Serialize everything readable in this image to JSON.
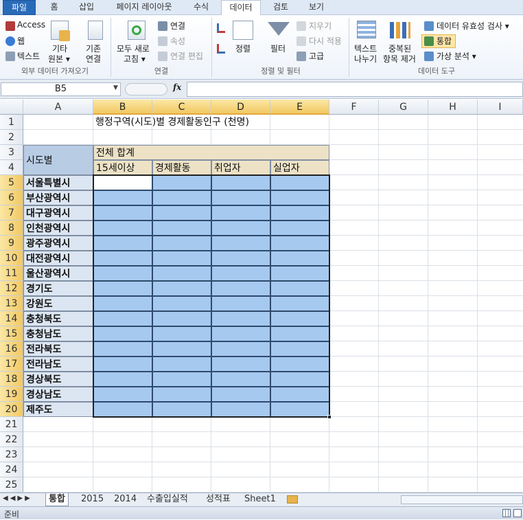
{
  "ribbon_tabs": [
    "파일",
    "홈",
    "삽입",
    "페이지 레이아웃",
    "수식",
    "데이터",
    "검토",
    "보기"
  ],
  "ribbon": {
    "ext_access": "Access",
    "ext_web": "웹",
    "ext_text": "텍스트",
    "ext_other_1": "기타",
    "ext_other_2": "원본 ▾",
    "existing_1": "기존",
    "existing_2": "연결",
    "group_external": "외부 데이터 가져오기",
    "refresh_1": "모두 새로",
    "refresh_2": "고침 ▾",
    "connections": "연결",
    "properties": "속성",
    "edit_links": "연결 편집",
    "group_connections": "연결",
    "sort": "정렬",
    "filter": "필터",
    "clear": "지우기",
    "reapply": "다시 적용",
    "advanced": "고급",
    "group_sort": "정렬 및 필터",
    "text_to_cols_1": "텍스트",
    "text_to_cols_2": "나누기",
    "remove_dup_1": "중복된",
    "remove_dup_2": "항목 제거",
    "validation": "데이터 유효성 검사 ▾",
    "consolidate": "통합",
    "whatif": "가상 분석 ▾",
    "group_tools": "데이터 도구"
  },
  "formula_bar": {
    "name_box": "B5",
    "fx": "fx",
    "formula": ""
  },
  "columns": [
    "A",
    "B",
    "C",
    "D",
    "E",
    "F",
    "G",
    "H",
    "I"
  ],
  "rows": [
    "1",
    "2",
    "3",
    "4",
    "5",
    "6",
    "7",
    "8",
    "9",
    "10",
    "11",
    "12",
    "13",
    "14",
    "15",
    "16",
    "17",
    "18",
    "19",
    "20",
    "21",
    "22",
    "23",
    "24",
    "25"
  ],
  "sheet": {
    "title": "행정구역(시도)별 경제활동인구 (천명)",
    "region_header": "시도별",
    "total_header": "전체 합계",
    "sub_headers": [
      "15세이상",
      "경제활동",
      "취업자",
      "실업자"
    ],
    "regions": [
      "서울특별시",
      "부산광역시",
      "대구광역시",
      "인천광역시",
      "광주광역시",
      "대전광역시",
      "울산광역시",
      "경기도",
      "강원도",
      "충청북도",
      "충청남도",
      "전라북도",
      "전라남도",
      "경상북도",
      "경상남도",
      "제주도"
    ]
  },
  "sheet_tabs": [
    "통합",
    "2015",
    "2014",
    "수출입실적",
    "성적표",
    "Sheet1"
  ],
  "status": "준비",
  "colors": {
    "selection": "#a6c9f0",
    "header_fill": "#ede2c6",
    "region_fill": "#dce6f2",
    "region_header_fill": "#b8cce4"
  }
}
